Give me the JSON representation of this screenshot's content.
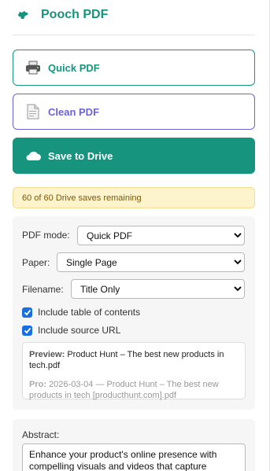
{
  "app": {
    "title": "Pooch PDF"
  },
  "actions": {
    "quick_pdf": "Quick PDF",
    "clean_pdf": "Clean PDF",
    "save_to_drive": "Save to Drive"
  },
  "quota": {
    "text": "60 of 60 Drive saves remaining"
  },
  "options": {
    "pdf_mode_label": "PDF mode:",
    "pdf_mode_value": "Quick PDF",
    "paper_label": "Paper:",
    "paper_value": "Single Page",
    "filename_label": "Filename:",
    "filename_value": "Title Only",
    "include_toc_label": "Include table of contents",
    "include_toc_checked": true,
    "include_source_label": "Include source URL",
    "include_source_checked": true
  },
  "preview": {
    "preview_label": "Preview:",
    "preview_value": "Product Hunt – The best new products in tech.pdf",
    "pro_label": "Pro:",
    "pro_value": "2026-03-04 — Product Hunt – The best new products in tech [producthunt.com].pdf"
  },
  "abstract": {
    "label": "Abstract:",
    "text": "Enhance your product's online presence with compelling visuals and videos that capture"
  },
  "colors": {
    "brand": "#16947e",
    "clean": "#6b63d8",
    "quota_bg": "#fdf3cd",
    "checkbox": "#1a6fe0"
  },
  "icons": {
    "logo": "dog-icon",
    "quick": "printer-icon",
    "clean": "document-icon",
    "drive": "cloud-icon"
  }
}
